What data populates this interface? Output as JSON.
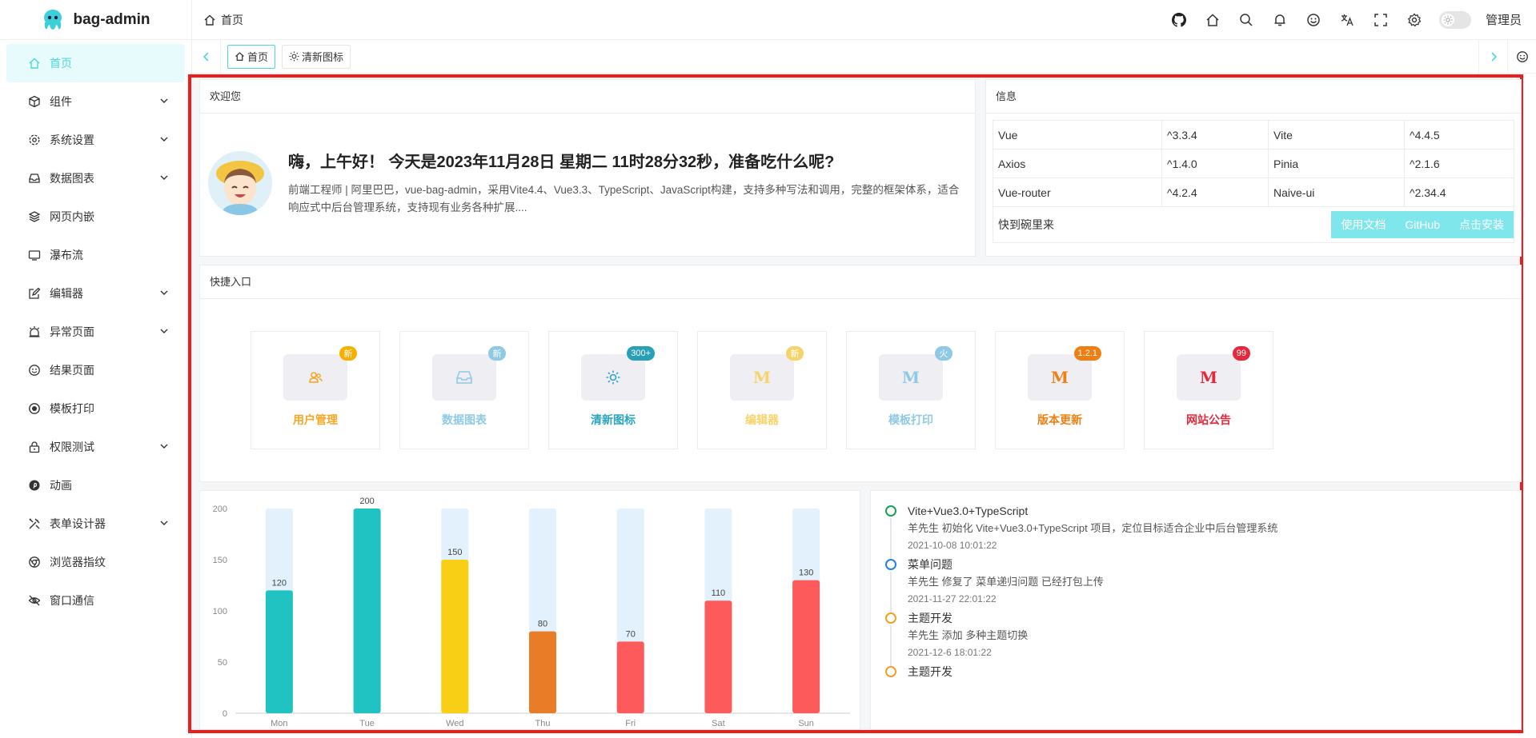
{
  "app": {
    "name": "bag-admin"
  },
  "sidebar": {
    "items": [
      {
        "label": "首页",
        "icon": "home-icon",
        "active": true,
        "expandable": false
      },
      {
        "label": "组件",
        "icon": "cube-icon",
        "expandable": true
      },
      {
        "label": "系统设置",
        "icon": "gear-icon",
        "expandable": true
      },
      {
        "label": "数据图表",
        "icon": "inbox-icon",
        "expandable": true
      },
      {
        "label": "网页内嵌",
        "icon": "layers-icon",
        "expandable": false
      },
      {
        "label": "瀑布流",
        "icon": "monitor-icon",
        "expandable": false
      },
      {
        "label": "编辑器",
        "icon": "edit-icon",
        "expandable": true
      },
      {
        "label": "异常页面",
        "icon": "alarm-icon",
        "expandable": true
      },
      {
        "label": "结果页面",
        "icon": "smile-icon",
        "expandable": false
      },
      {
        "label": "模板打印",
        "icon": "record-icon",
        "expandable": false
      },
      {
        "label": "权限测试",
        "icon": "lock-icon",
        "expandable": true
      },
      {
        "label": "动画",
        "icon": "pinterest-icon",
        "expandable": false
      },
      {
        "label": "表单设计器",
        "icon": "tools-icon",
        "expandable": true
      },
      {
        "label": "浏览器指纹",
        "icon": "chrome-icon",
        "expandable": false
      },
      {
        "label": "窗口通信",
        "icon": "eye-off-icon",
        "expandable": false
      }
    ]
  },
  "header": {
    "breadcrumb": "首页",
    "icons": [
      "github-icon",
      "home-icon",
      "search-icon",
      "bell-icon",
      "smile-icon",
      "translate-icon",
      "fullscreen-icon",
      "gear-icon"
    ],
    "user": "管理员"
  },
  "tabs": [
    {
      "label": "首页",
      "icon": "home-icon",
      "active": true
    },
    {
      "label": "清新图标",
      "icon": "sun-icon",
      "active": false
    }
  ],
  "welcome": {
    "heading": "欢迎您",
    "greeting": "嗨，上午好！ 今天是2023年11月28日 星期二 11时28分32秒，准备吃什么呢?",
    "description": "前端工程师 | 阿里巴巴，vue-bag-admin，采用Vite4.4、Vue3.3、TypeScript、JavaScript构建，支持多种写法和调用，完整的框架体系，适合响应式中后台管理系统，支持现有业务各种扩展...."
  },
  "info": {
    "heading": "信息",
    "rows": [
      [
        "Vue",
        "^3.3.4",
        "Vite",
        "^4.4.5"
      ],
      [
        "Axios",
        "^1.4.0",
        "Pinia",
        "^2.1.6"
      ],
      [
        "Vue-router",
        "^4.2.4",
        "Naive-ui",
        "^2.34.4"
      ]
    ],
    "links_label": "快到碗里来",
    "links": [
      "使用文档",
      "GitHub",
      "点击安装"
    ]
  },
  "quick": {
    "heading": "快捷入口",
    "items": [
      {
        "label": "用户管理",
        "badge": "新",
        "icon": "users-icon",
        "glyph": "",
        "color": "#f5a623",
        "badge_color": "#f5b000"
      },
      {
        "label": "数据图表",
        "badge": "新",
        "icon": "inbox-icon",
        "glyph": "",
        "color": "#8ec9e6",
        "badge_color": "#8ec9e6"
      },
      {
        "label": "清新图标",
        "badge": "300+",
        "icon": "sun-icon",
        "glyph": "",
        "color": "#2aa4bf",
        "badge_color": "#2a9fb8"
      },
      {
        "label": "编辑器",
        "badge": "新",
        "icon": "m-icon",
        "glyph": "M",
        "color": "#f7d36b",
        "badge_color": "#f7d36b"
      },
      {
        "label": "模板打印",
        "badge": "火",
        "icon": "m-icon",
        "glyph": "M",
        "color": "#8ec9e6",
        "badge_color": "#8ec9e6"
      },
      {
        "label": "版本更新",
        "badge": "1.2.1",
        "icon": "m-icon",
        "glyph": "M",
        "color": "#f07f13",
        "badge_color": "#f07f13"
      },
      {
        "label": "网站公告",
        "badge": "99",
        "icon": "m-icon",
        "glyph": "M",
        "color": "#e6283c",
        "badge_color": "#e6283c"
      }
    ]
  },
  "chart_data": {
    "type": "bar",
    "categories": [
      "Mon",
      "Tue",
      "Wed",
      "Thu",
      "Fri",
      "Sat",
      "Sun"
    ],
    "values": [
      120,
      200,
      150,
      80,
      70,
      110,
      130
    ],
    "colors": [
      "#21c2c2",
      "#21c2c2",
      "#f9cf16",
      "#e97c26",
      "#fd5b5b",
      "#fd5b5b",
      "#fd5b5b"
    ],
    "background_value": 200,
    "background_color": "#e2f1fb",
    "ylim": [
      0,
      200
    ],
    "yticks": [
      0,
      50,
      100,
      150,
      200
    ],
    "title": "",
    "xlabel": "",
    "ylabel": ""
  },
  "timeline": [
    {
      "title": "Vite+Vue3.0+TypeScript",
      "text": "羊先生 初始化 Vite+Vue3.0+TypeScript 项目，定位目标适合企业中后台管理系统",
      "time": "2021-10-08 10:01:22",
      "color": "#18a058"
    },
    {
      "title": "菜单问题",
      "text": "羊先生 修复了 菜单递归问题 已经打包上传",
      "time": "2021-11-27 22:01:22",
      "color": "#2080f0"
    },
    {
      "title": "主题开发",
      "text": "羊先生 添加 多种主题切换",
      "time": "2021-12-6 18:01:22",
      "color": "#f0a020"
    },
    {
      "title": "主题开发",
      "text": "",
      "time": "",
      "color": "#f0a020"
    }
  ]
}
